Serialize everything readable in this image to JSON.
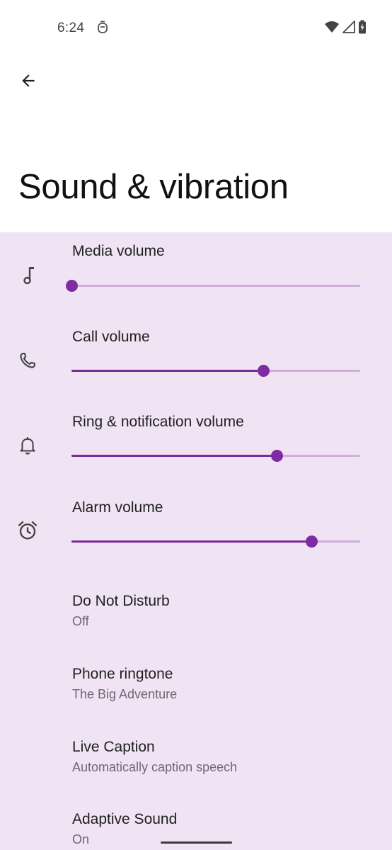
{
  "status_bar": {
    "time": "6:24"
  },
  "header": {
    "title": "Sound & vibration"
  },
  "volumes": [
    {
      "label": "Media volume",
      "icon": "music-note-icon",
      "level": 0.0
    },
    {
      "label": "Call volume",
      "icon": "phone-icon",
      "level": 0.665
    },
    {
      "label": "Ring & notification volume",
      "icon": "bell-icon",
      "level": 0.713
    },
    {
      "label": "Alarm volume",
      "icon": "alarm-clock-icon",
      "level": 0.832
    }
  ],
  "settings": [
    {
      "title": "Do Not Disturb",
      "summary": "Off"
    },
    {
      "title": "Phone ringtone",
      "summary": "The Big Adventure"
    },
    {
      "title": "Live Caption",
      "summary": "Automatically caption speech"
    },
    {
      "title": "Adaptive Sound",
      "summary": "On"
    }
  ],
  "colors": {
    "accent": "#7f2ca3",
    "track": "#cfb0da",
    "content_bg": "#f0e3f3"
  }
}
